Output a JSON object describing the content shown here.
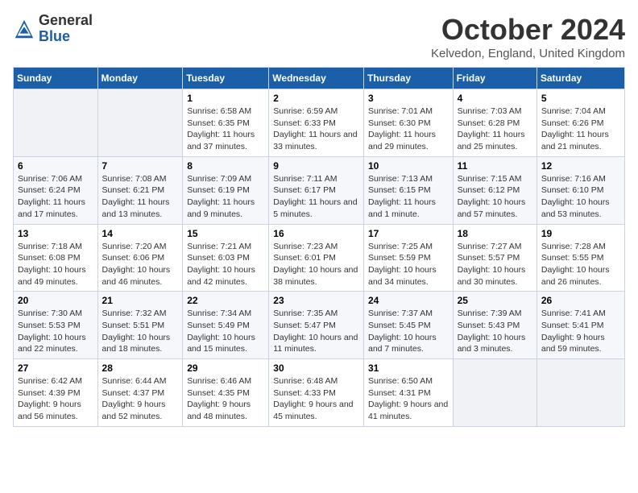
{
  "logo": {
    "general": "General",
    "blue": "Blue"
  },
  "title": "October 2024",
  "location": "Kelvedon, England, United Kingdom",
  "days_of_week": [
    "Sunday",
    "Monday",
    "Tuesday",
    "Wednesday",
    "Thursday",
    "Friday",
    "Saturday"
  ],
  "weeks": [
    [
      {
        "day": "",
        "info": ""
      },
      {
        "day": "",
        "info": ""
      },
      {
        "day": "1",
        "info": "Sunrise: 6:58 AM\nSunset: 6:35 PM\nDaylight: 11 hours and 37 minutes."
      },
      {
        "day": "2",
        "info": "Sunrise: 6:59 AM\nSunset: 6:33 PM\nDaylight: 11 hours and 33 minutes."
      },
      {
        "day": "3",
        "info": "Sunrise: 7:01 AM\nSunset: 6:30 PM\nDaylight: 11 hours and 29 minutes."
      },
      {
        "day": "4",
        "info": "Sunrise: 7:03 AM\nSunset: 6:28 PM\nDaylight: 11 hours and 25 minutes."
      },
      {
        "day": "5",
        "info": "Sunrise: 7:04 AM\nSunset: 6:26 PM\nDaylight: 11 hours and 21 minutes."
      }
    ],
    [
      {
        "day": "6",
        "info": "Sunrise: 7:06 AM\nSunset: 6:24 PM\nDaylight: 11 hours and 17 minutes."
      },
      {
        "day": "7",
        "info": "Sunrise: 7:08 AM\nSunset: 6:21 PM\nDaylight: 11 hours and 13 minutes."
      },
      {
        "day": "8",
        "info": "Sunrise: 7:09 AM\nSunset: 6:19 PM\nDaylight: 11 hours and 9 minutes."
      },
      {
        "day": "9",
        "info": "Sunrise: 7:11 AM\nSunset: 6:17 PM\nDaylight: 11 hours and 5 minutes."
      },
      {
        "day": "10",
        "info": "Sunrise: 7:13 AM\nSunset: 6:15 PM\nDaylight: 11 hours and 1 minute."
      },
      {
        "day": "11",
        "info": "Sunrise: 7:15 AM\nSunset: 6:12 PM\nDaylight: 10 hours and 57 minutes."
      },
      {
        "day": "12",
        "info": "Sunrise: 7:16 AM\nSunset: 6:10 PM\nDaylight: 10 hours and 53 minutes."
      }
    ],
    [
      {
        "day": "13",
        "info": "Sunrise: 7:18 AM\nSunset: 6:08 PM\nDaylight: 10 hours and 49 minutes."
      },
      {
        "day": "14",
        "info": "Sunrise: 7:20 AM\nSunset: 6:06 PM\nDaylight: 10 hours and 46 minutes."
      },
      {
        "day": "15",
        "info": "Sunrise: 7:21 AM\nSunset: 6:03 PM\nDaylight: 10 hours and 42 minutes."
      },
      {
        "day": "16",
        "info": "Sunrise: 7:23 AM\nSunset: 6:01 PM\nDaylight: 10 hours and 38 minutes."
      },
      {
        "day": "17",
        "info": "Sunrise: 7:25 AM\nSunset: 5:59 PM\nDaylight: 10 hours and 34 minutes."
      },
      {
        "day": "18",
        "info": "Sunrise: 7:27 AM\nSunset: 5:57 PM\nDaylight: 10 hours and 30 minutes."
      },
      {
        "day": "19",
        "info": "Sunrise: 7:28 AM\nSunset: 5:55 PM\nDaylight: 10 hours and 26 minutes."
      }
    ],
    [
      {
        "day": "20",
        "info": "Sunrise: 7:30 AM\nSunset: 5:53 PM\nDaylight: 10 hours and 22 minutes."
      },
      {
        "day": "21",
        "info": "Sunrise: 7:32 AM\nSunset: 5:51 PM\nDaylight: 10 hours and 18 minutes."
      },
      {
        "day": "22",
        "info": "Sunrise: 7:34 AM\nSunset: 5:49 PM\nDaylight: 10 hours and 15 minutes."
      },
      {
        "day": "23",
        "info": "Sunrise: 7:35 AM\nSunset: 5:47 PM\nDaylight: 10 hours and 11 minutes."
      },
      {
        "day": "24",
        "info": "Sunrise: 7:37 AM\nSunset: 5:45 PM\nDaylight: 10 hours and 7 minutes."
      },
      {
        "day": "25",
        "info": "Sunrise: 7:39 AM\nSunset: 5:43 PM\nDaylight: 10 hours and 3 minutes."
      },
      {
        "day": "26",
        "info": "Sunrise: 7:41 AM\nSunset: 5:41 PM\nDaylight: 9 hours and 59 minutes."
      }
    ],
    [
      {
        "day": "27",
        "info": "Sunrise: 6:42 AM\nSunset: 4:39 PM\nDaylight: 9 hours and 56 minutes."
      },
      {
        "day": "28",
        "info": "Sunrise: 6:44 AM\nSunset: 4:37 PM\nDaylight: 9 hours and 52 minutes."
      },
      {
        "day": "29",
        "info": "Sunrise: 6:46 AM\nSunset: 4:35 PM\nDaylight: 9 hours and 48 minutes."
      },
      {
        "day": "30",
        "info": "Sunrise: 6:48 AM\nSunset: 4:33 PM\nDaylight: 9 hours and 45 minutes."
      },
      {
        "day": "31",
        "info": "Sunrise: 6:50 AM\nSunset: 4:31 PM\nDaylight: 9 hours and 41 minutes."
      },
      {
        "day": "",
        "info": ""
      },
      {
        "day": "",
        "info": ""
      }
    ]
  ]
}
